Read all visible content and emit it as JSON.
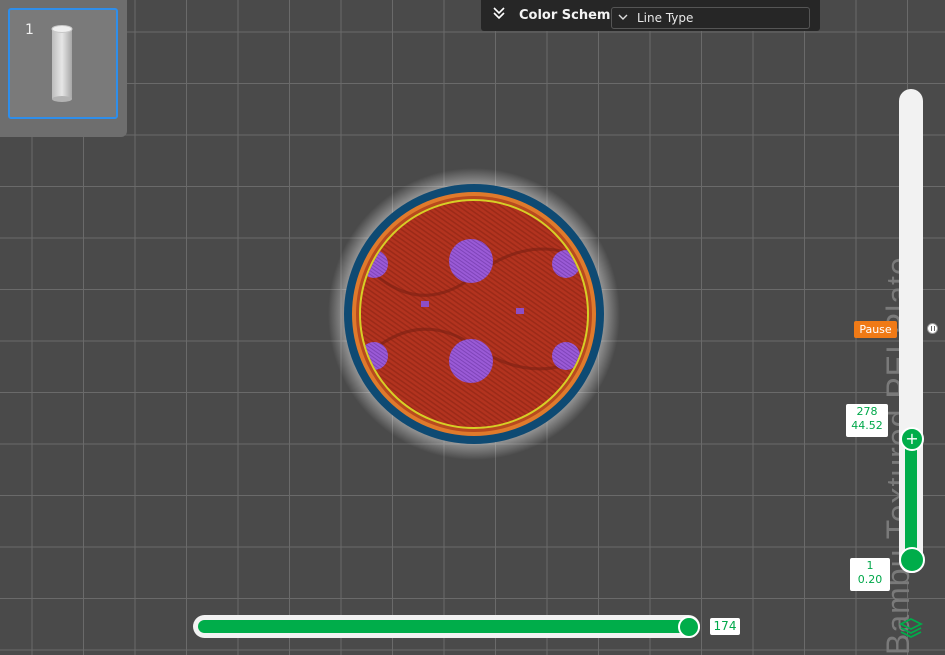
{
  "thumbnail": {
    "plate_number": "1"
  },
  "color_scheme": {
    "label": "Color Scheme",
    "selected": "Line Type"
  },
  "plate": {
    "name": "Bambu Textured PEI Plate"
  },
  "layer_slider": {
    "pause_label": "Pause",
    "top_layer": "278",
    "top_height": "44.52",
    "bottom_layer": "1",
    "bottom_height": "0.20",
    "fill_fraction": 0.26
  },
  "move_slider": {
    "value": "174",
    "fill_fraction": 0.98
  },
  "colors": {
    "accent_green": "#00ad4a",
    "pause_orange": "#f07a16",
    "selection_blue": "#2f8eea",
    "inner_wall": "#b0321e",
    "outer_wall": "#0e4a73",
    "support": "#8f52c8"
  }
}
